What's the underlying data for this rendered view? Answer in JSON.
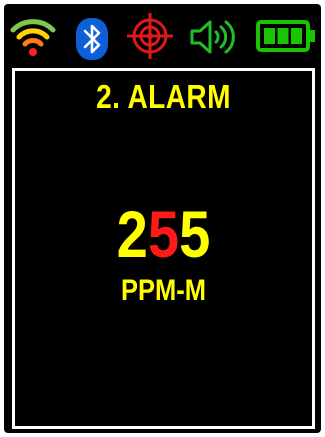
{
  "status_bar": {
    "icons": [
      "wifi-icon",
      "bluetooth-icon",
      "target-icon",
      "speaker-icon",
      "battery-icon"
    ],
    "battery_level": 1.0,
    "colors": {
      "wifi_outer": "#7ec850",
      "wifi_middle": "#ffd400",
      "wifi_inner": "#ff7a1a",
      "wifi_dot": "#ff2020",
      "bluetooth_bg": "#0d5fd8",
      "target": "#e01818",
      "speaker": "#1fbf2a",
      "battery": "#19c400"
    }
  },
  "screen": {
    "title": "2. ALARM",
    "reading": {
      "digits": [
        {
          "char": "2",
          "state": "normal"
        },
        {
          "char": "5",
          "state": "alert"
        },
        {
          "char": "5",
          "state": "normal"
        }
      ]
    },
    "unit": "PPM-M",
    "colors": {
      "text": "#ffff00",
      "alert": "#ff1a1a",
      "border": "#ffffff",
      "background": "#000000"
    }
  }
}
